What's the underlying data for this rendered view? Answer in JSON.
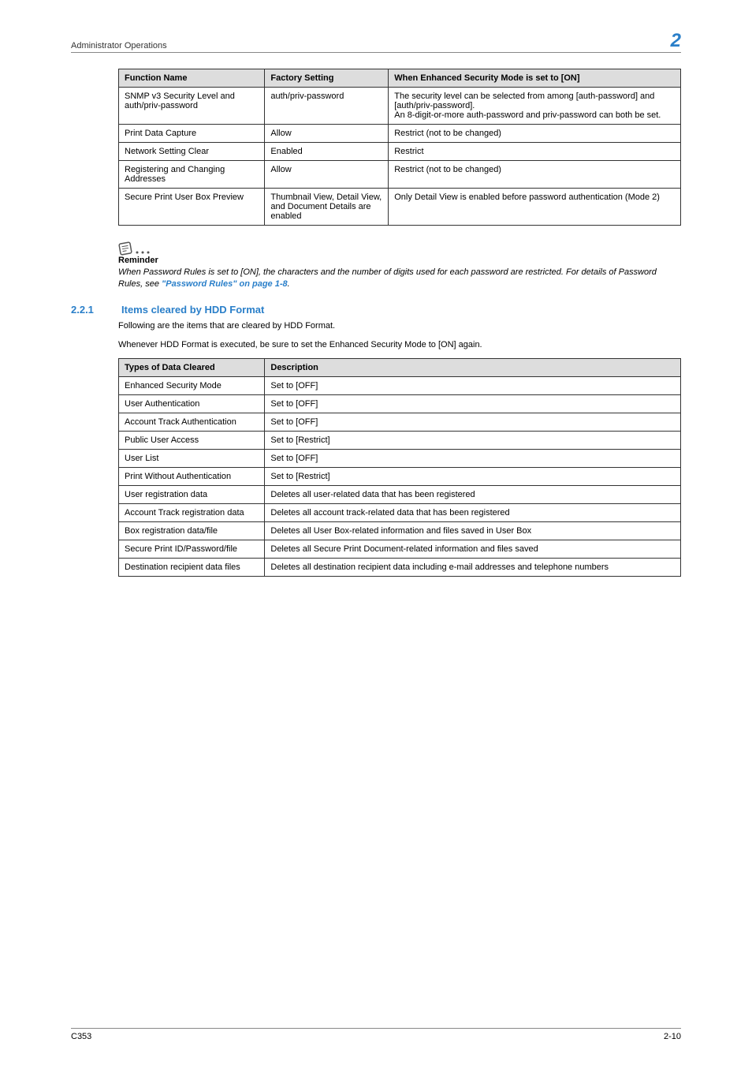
{
  "header": {
    "section": "Administrator Operations",
    "chapterNum": "2"
  },
  "table1": {
    "headers": [
      "Function Name",
      "Factory Setting",
      "When Enhanced Security Mode is set to [ON]"
    ],
    "rows": [
      [
        "SNMP v3 Security Level and auth/priv-password",
        "auth/priv-password",
        "The security level can be selected from among [auth-password] and [auth/priv-password].\nAn 8-digit-or-more auth-password and priv-password can both be set."
      ],
      [
        "Print Data Capture",
        "Allow",
        "Restrict (not to be changed)"
      ],
      [
        "Network Setting Clear",
        "Enabled",
        "Restrict"
      ],
      [
        "Registering and Changing Addresses",
        "Allow",
        "Restrict (not to be changed)"
      ],
      [
        "Secure Print User Box Preview",
        "Thumbnail View, Detail View, and Document Details are enabled",
        "Only Detail View is enabled before password authentication (Mode 2)"
      ]
    ]
  },
  "reminder": {
    "label": "Reminder",
    "text1": "When Password Rules is set to [ON], the characters and the number of digits used for each password are restricted. For details of Password Rules, see ",
    "link": "\"Password Rules\" on page 1-8",
    "text2": "."
  },
  "section": {
    "num": "2.2.1",
    "title": "Items cleared by HDD Format",
    "p1": "Following are the items that are cleared by HDD Format.",
    "p2": "Whenever HDD Format is executed, be sure to set the Enhanced Security Mode to [ON] again."
  },
  "table2": {
    "headers": [
      "Types of Data Cleared",
      "Description"
    ],
    "rows": [
      [
        "Enhanced Security Mode",
        "Set to [OFF]"
      ],
      [
        "User Authentication",
        "Set to [OFF]"
      ],
      [
        "Account Track Authentication",
        "Set to [OFF]"
      ],
      [
        "Public User Access",
        "Set to [Restrict]"
      ],
      [
        "User List",
        "Set to [OFF]"
      ],
      [
        "Print Without Authentication",
        "Set to [Restrict]"
      ],
      [
        "User registration data",
        "Deletes all user-related data that has been registered"
      ],
      [
        "Account Track registration data",
        "Deletes all account track-related data that has been registered"
      ],
      [
        "Box registration data/file",
        "Deletes all User Box-related information and files saved in User Box"
      ],
      [
        "Secure Print ID/Password/file",
        "Deletes all Secure Print Document-related information and files saved"
      ],
      [
        "Destination recipient data files",
        "Deletes all destination recipient data including e-mail addresses and telephone numbers"
      ]
    ]
  },
  "footer": {
    "left": "C353",
    "right": "2-10"
  }
}
